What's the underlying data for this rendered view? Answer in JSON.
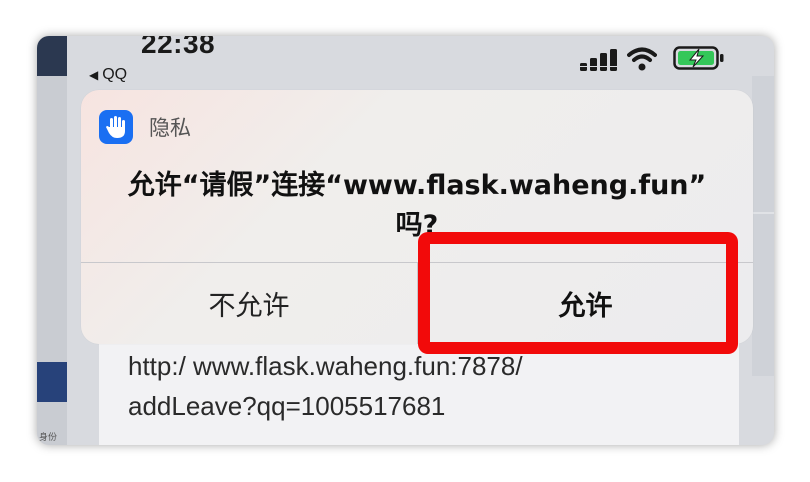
{
  "status_bar": {
    "time": "22:38",
    "back_app": "QQ",
    "back_icon": "back-arrow-icon"
  },
  "background": {
    "left_strip_text": "身份"
  },
  "sheet": {
    "url_line1": "http:/ www.flask.waheng.fun:7878/",
    "url_line2": "addLeave?qq=1005517681"
  },
  "alert": {
    "icon": "privacy-hand-icon",
    "source": "隐私",
    "message_line1": "允许“请假”连接“www.flask.waheng.fun”",
    "message_line2": "吗?",
    "deny_label": "不允许",
    "allow_label": "允许"
  },
  "colors": {
    "highlight": "#f20a0a",
    "privacy_icon_bg": "#1a6ff2",
    "battery_fill": "#34c759"
  }
}
